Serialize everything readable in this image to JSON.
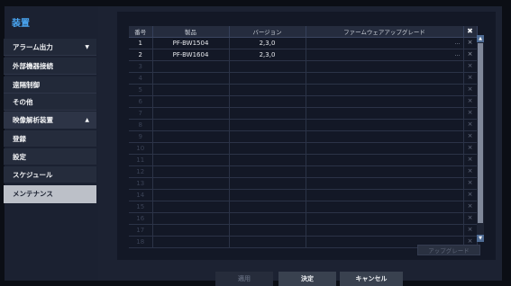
{
  "sidebar": {
    "title": "装置",
    "items": [
      {
        "label": "アラーム出力",
        "arrow": "▼"
      },
      {
        "label": "外部機器接続"
      },
      {
        "label": "遠隔制御"
      },
      {
        "label": "その他"
      },
      {
        "label": "映像解析装置",
        "arrow": "▲"
      },
      {
        "label": "登録"
      },
      {
        "label": "設定"
      },
      {
        "label": "スケジュール"
      },
      {
        "label": "メンテナンス"
      }
    ]
  },
  "table": {
    "headers": [
      "番号",
      "製品",
      "バージョン",
      "ファームウェアアップグレード"
    ],
    "delete_header": "✖",
    "rows": [
      {
        "num": "1",
        "product": "PF-BW1504",
        "version": "2,3,0"
      },
      {
        "num": "2",
        "product": "PF-BW1604",
        "version": "2,3,0"
      },
      {
        "num": "3"
      },
      {
        "num": "4"
      },
      {
        "num": "5"
      },
      {
        "num": "6"
      },
      {
        "num": "7"
      },
      {
        "num": "8"
      },
      {
        "num": "9"
      },
      {
        "num": "10"
      },
      {
        "num": "11"
      },
      {
        "num": "12"
      },
      {
        "num": "13"
      },
      {
        "num": "14"
      },
      {
        "num": "15"
      },
      {
        "num": "16"
      },
      {
        "num": "17"
      },
      {
        "num": "18"
      }
    ]
  },
  "upgrade_button": "アップグレード",
  "buttons": {
    "apply": "適用",
    "ok": "決定",
    "cancel": "キャンセル"
  }
}
